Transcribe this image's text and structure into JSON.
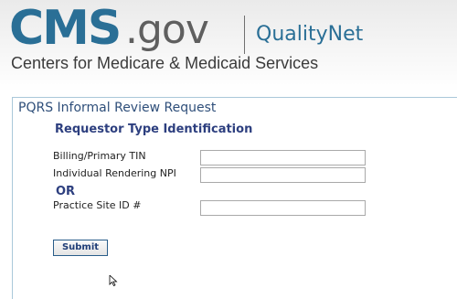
{
  "header": {
    "logo_cms": "CMS",
    "logo_dotgov": ".gov",
    "logo_qualitynet": "QualityNet",
    "tagline": "Centers for Medicare & Medicaid Services"
  },
  "form": {
    "title": "PQRS Informal Review Request",
    "section_heading": "Requestor Type Identification",
    "fields": {
      "tin_label": "Billing/Primary TIN",
      "tin_value": "",
      "npi_label": "Individual Rendering NPI",
      "npi_value": "",
      "or_label": "OR",
      "site_label": "Practice Site ID #",
      "site_value": ""
    },
    "submit_label": "Submit"
  },
  "colors": {
    "brand_blue": "#2a6f96",
    "heading_navy": "#2d3f7f",
    "gray_text": "#5f5f5f"
  },
  "icons": {
    "cursor": "mouse-pointer-icon"
  }
}
